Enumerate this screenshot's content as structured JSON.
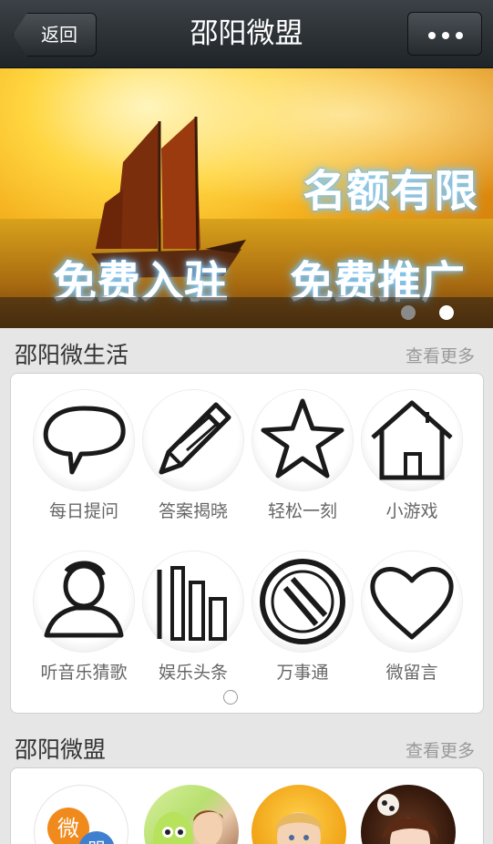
{
  "nav": {
    "back_label": "返回",
    "title": "邵阳微盟"
  },
  "banner": {
    "text_limited": "名额有限",
    "text_free_join": "免费入驻",
    "text_free_promo": "免费推广",
    "pager_total": 2,
    "pager_active": 2
  },
  "section_life": {
    "title": "邵阳微生活",
    "more": "查看更多",
    "items": [
      {
        "label": "每日提问",
        "icon": "speech-bubble-icon"
      },
      {
        "label": "答案揭晓",
        "icon": "pencil-icon"
      },
      {
        "label": "轻松一刻",
        "icon": "star-icon"
      },
      {
        "label": "小游戏",
        "icon": "house-icon"
      },
      {
        "label": "听音乐猜歌",
        "icon": "person-icon"
      },
      {
        "label": "娱乐头条",
        "icon": "bar-chart-icon"
      },
      {
        "label": "万事通",
        "icon": "stripes-circle-icon"
      },
      {
        "label": "微留言",
        "icon": "heart-icon"
      }
    ]
  },
  "section_alliance": {
    "title": "邵阳微盟",
    "more": "查看更多",
    "avatar_logo_text": "微盟"
  },
  "colors": {
    "topbar": "#2b3034",
    "page_bg": "#e6e6e6",
    "card_bg": "#ffffff",
    "label_gray": "#666666",
    "more_gray": "#999999"
  }
}
